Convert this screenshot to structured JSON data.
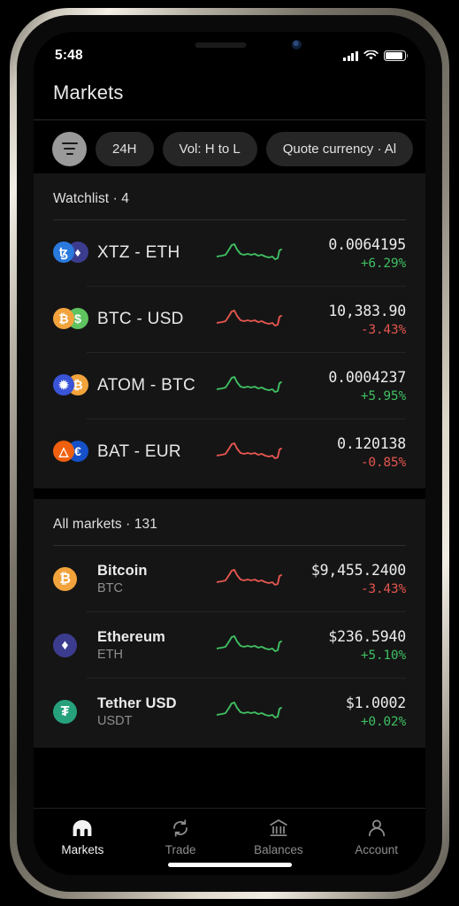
{
  "status_bar": {
    "time": "5:48",
    "signal_icon": "cellular-signal-icon",
    "wifi_icon": "wifi-icon",
    "battery_icon": "battery-icon"
  },
  "header": {
    "title": "Markets"
  },
  "filters": {
    "filter_button_icon": "filter-icon",
    "chips": [
      {
        "label": "24H",
        "name": "chip-timeframe"
      },
      {
        "label": "Vol: H to L",
        "name": "chip-volume-sort"
      },
      {
        "label": "Quote currency · Al",
        "name": "chip-quote-currency"
      }
    ]
  },
  "watchlist": {
    "title": "Watchlist · 4",
    "rows": [
      {
        "pair": "XTZ - ETH",
        "price": "0.0064195",
        "delta": "+6.29%",
        "dir": "up",
        "base": "ꜩ",
        "quote": "♦",
        "base_class": "c-xtz",
        "quote_class": "c-eth"
      },
      {
        "pair": "BTC - USD",
        "price": "10,383.90",
        "delta": "-3.43%",
        "dir": "down",
        "base": "₿",
        "quote": "$",
        "base_class": "c-btc",
        "quote_class": "c-usd"
      },
      {
        "pair": "ATOM - BTC",
        "price": "0.0004237",
        "delta": "+5.95%",
        "dir": "up",
        "base": "✹",
        "quote": "₿",
        "base_class": "c-atom",
        "quote_class": "c-btc"
      },
      {
        "pair": "BAT - EUR",
        "price": "0.120138",
        "delta": "-0.85%",
        "dir": "down",
        "base": "△",
        "quote": "€",
        "base_class": "c-bat",
        "quote_class": "c-eur"
      }
    ]
  },
  "all_markets": {
    "title": "All markets · 131",
    "rows": [
      {
        "name": "Bitcoin",
        "symbol": "BTC",
        "price": "$9,455.2400",
        "delta": "-3.43%",
        "dir": "down",
        "glyph": "₿",
        "glyph_class": "c-btc"
      },
      {
        "name": "Ethereum",
        "symbol": "ETH",
        "price": "$236.5940",
        "delta": "+5.10%",
        "dir": "up",
        "glyph": "♦",
        "glyph_class": "c-eth"
      },
      {
        "name": "Tether USD",
        "symbol": "USDT",
        "price": "$1.0002",
        "delta": "+0.02%",
        "dir": "up",
        "glyph": "₮",
        "glyph_class": "c-usdt"
      }
    ]
  },
  "tabbar": {
    "tabs": [
      {
        "label": "Markets",
        "icon": "kraken-logo-icon",
        "active": true
      },
      {
        "label": "Trade",
        "icon": "refresh-arrows-icon",
        "active": false
      },
      {
        "label": "Balances",
        "icon": "bank-building-icon",
        "active": false
      },
      {
        "label": "Account",
        "icon": "person-icon",
        "active": false
      }
    ]
  },
  "colors": {
    "up": "#3fbf62",
    "down": "#e4564f",
    "card": "#151515",
    "page": "#000000"
  }
}
